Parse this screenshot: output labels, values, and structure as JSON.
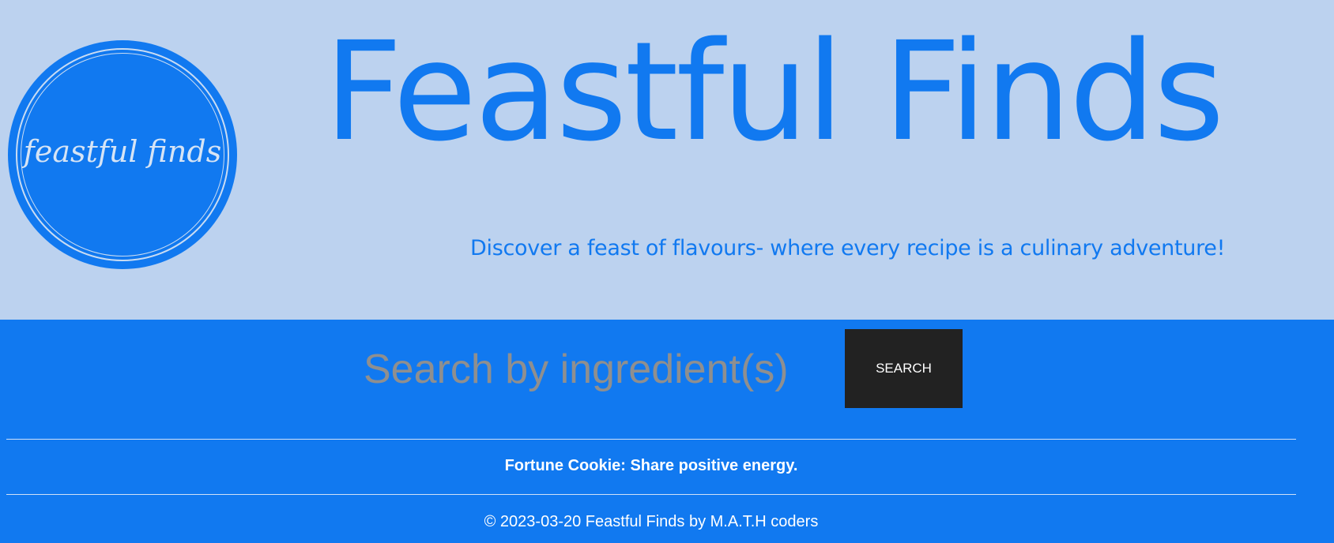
{
  "header": {
    "logo_text": "feastful finds",
    "title": "Feastful Finds",
    "tagline": "Discover a feast of flavours- where every recipe is a culinary adventure!"
  },
  "search": {
    "placeholder": "Search by ingredient(s)",
    "button_label": "SEARCH"
  },
  "footer": {
    "fortune": "Fortune Cookie: Share positive energy.",
    "copyright": "© 2023-03-20 Feastful Finds by M.A.T.H coders"
  },
  "colors": {
    "header_background": "#bcd2ef",
    "brand_blue": "#1179f0",
    "button_background": "#222222",
    "placeholder_gray": "#8f8f8f",
    "footer_text": "#ffffff"
  }
}
